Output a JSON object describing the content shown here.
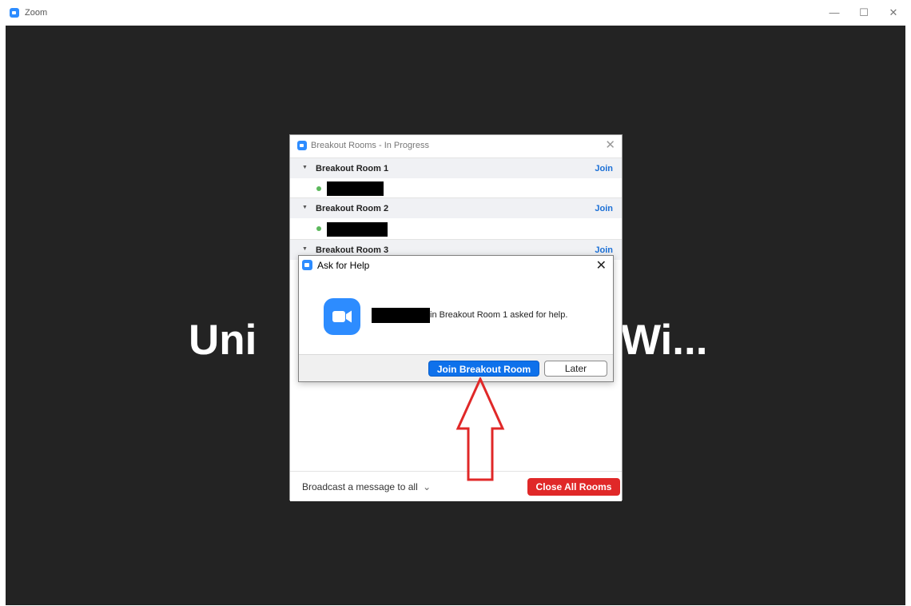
{
  "window": {
    "title": "Zoom",
    "min_glyph": "—",
    "max_glyph": "☐",
    "close_glyph": "✕"
  },
  "background": {
    "name_left": "Uni",
    "name_right": "Wi..."
  },
  "breakout_dialog": {
    "title": "Breakout Rooms - In Progress",
    "close_glyph": "✕",
    "rooms": [
      {
        "name": "Breakout Room 1",
        "join": "Join"
      },
      {
        "name": "Breakout Room 2",
        "join": "Join"
      },
      {
        "name": "Breakout Room 3",
        "join": "Join"
      }
    ],
    "caret": "▼",
    "broadcast_label": "Broadcast a message to all",
    "broadcast_caret": "⌄",
    "close_all_label": "Close All Rooms",
    "colors": {
      "join": "#1a6fd6",
      "close_all": "#e02828",
      "member_dot": "#5cb85c"
    }
  },
  "help_dialog": {
    "title": "Ask for Help",
    "close_glyph": "✕",
    "message": "in Breakout Room 1 asked for help.",
    "join_button": "Join Breakout Room",
    "later_button": "Later",
    "icon": "zoom-camera-icon",
    "colors": {
      "primary": "#0e71eb",
      "icon_bg": "#2d8cff"
    }
  },
  "annotation": {
    "arrow_color": "#e02828"
  }
}
